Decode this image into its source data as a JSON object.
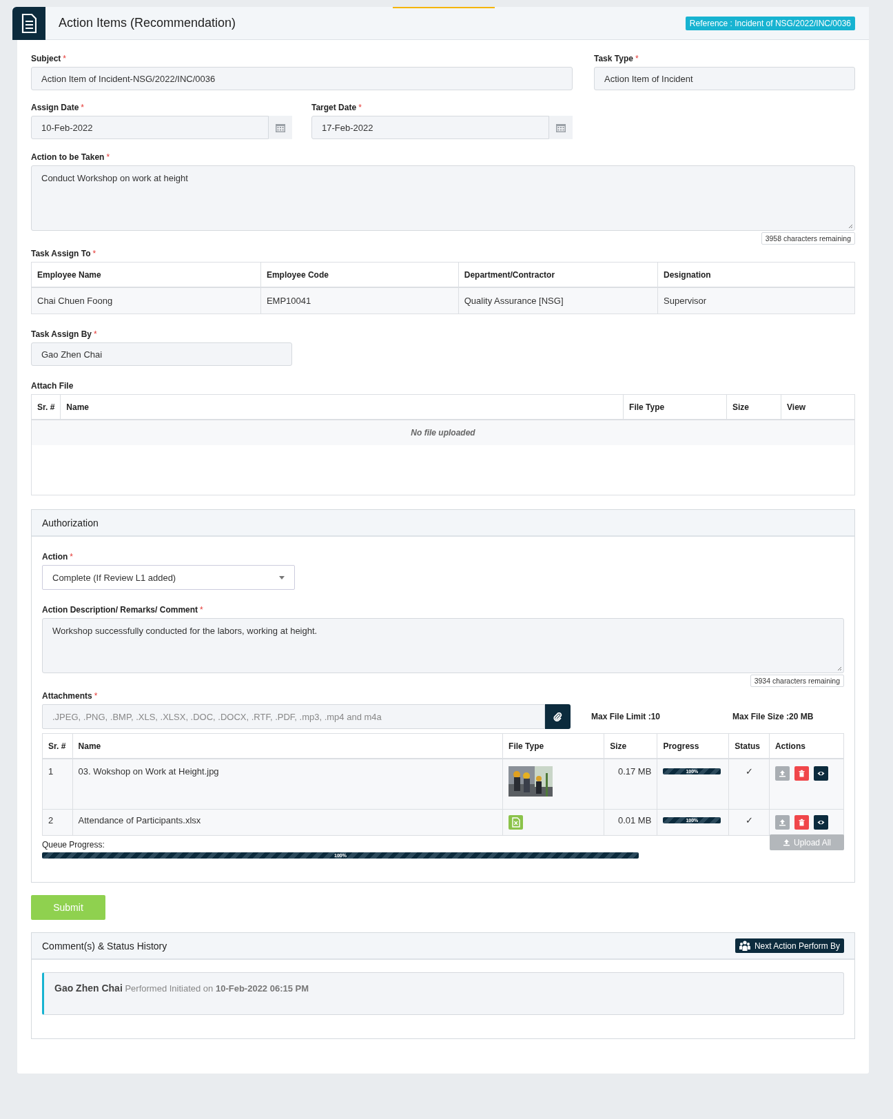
{
  "page": {
    "title": "Action Items (Recommendation)",
    "reference": "Reference : Incident of NSG/2022/INC/0036"
  },
  "subject": {
    "label": "Subject",
    "mark": "*",
    "value": "Action Item of Incident-NSG/2022/INC/0036"
  },
  "task_type": {
    "label": "Task Type",
    "mark": "*",
    "value": "Action Item of Incident"
  },
  "assign_date": {
    "label": "Assign Date",
    "mark": "*",
    "value": "10-Feb-2022"
  },
  "target_date": {
    "label": "Target Date",
    "mark": "*",
    "value": "17-Feb-2022"
  },
  "action_to_be_taken": {
    "label": "Action to be Taken",
    "mark": "*",
    "value": "Conduct Workshop on work at height",
    "counter": "3958 characters remaining"
  },
  "task_assign_to": {
    "label": "Task Assign To",
    "mark": "*",
    "columns": [
      "Employee Name",
      "Employee Code",
      "Department/Contractor",
      "Designation"
    ],
    "rows": [
      [
        "Chai Chuen Foong",
        "EMP10041",
        "Quality Assurance [NSG]",
        "Supervisor"
      ]
    ]
  },
  "task_assign_by": {
    "label": "Task Assign By",
    "mark": "*",
    "value": "Gao Zhen Chai"
  },
  "attach_file": {
    "label": "Attach File",
    "columns": [
      "Sr. #",
      "Name",
      "File Type",
      "Size",
      "View"
    ],
    "empty_text": "No file uploaded"
  },
  "authorization": {
    "title": "Authorization",
    "action": {
      "label": "Action",
      "mark": "*",
      "value": "Complete (If Review L1 added)"
    },
    "description": {
      "label": "Action Description/ Remarks/ Comment",
      "mark": "*",
      "value": "Workshop successfully conducted for the labors, working at height.",
      "counter": "3934 characters remaining"
    },
    "attachments": {
      "label": "Attachments",
      "mark": "*",
      "placeholder": ".JPEG, .PNG, .BMP, .XLS, .XLSX, .DOC, .DOCX, .RTF, .PDF, .mp3, .mp4 and m4a",
      "max_file_limit": "Max File Limit :10",
      "max_file_size": "Max File Size :20 MB",
      "columns": [
        "Sr. #",
        "Name",
        "File Type",
        "Size",
        "Progress",
        "Status",
        "Actions"
      ],
      "rows": [
        {
          "sr": "1",
          "name": "03. Wokshop on Work at Height.jpg",
          "size": "0.17 MB",
          "level": 1,
          "progress_label": "100%",
          "status": "✓"
        },
        {
          "sr": "2",
          "name": "Attendance of Participants.xlsx",
          "kind": "spreadsheet",
          "size": "0.01 MB",
          "level": 1,
          "progress_label": "100%",
          "status": "✓"
        }
      ]
    },
    "queue": {
      "label": "Queue Progress:",
      "level": 1,
      "progress_label": "100%"
    },
    "upload_all": {
      "label": "Upload All",
      "disabled": true
    }
  },
  "submit": {
    "label": "Submit"
  },
  "history": {
    "title": "Comment(s) & Status History",
    "next_action": "Next Action Perform By",
    "entries": [
      {
        "name": "Gao Zhen Chai",
        "text": "Performed Initiated on",
        "date": "10-Feb-2022 06:15 PM"
      }
    ]
  }
}
